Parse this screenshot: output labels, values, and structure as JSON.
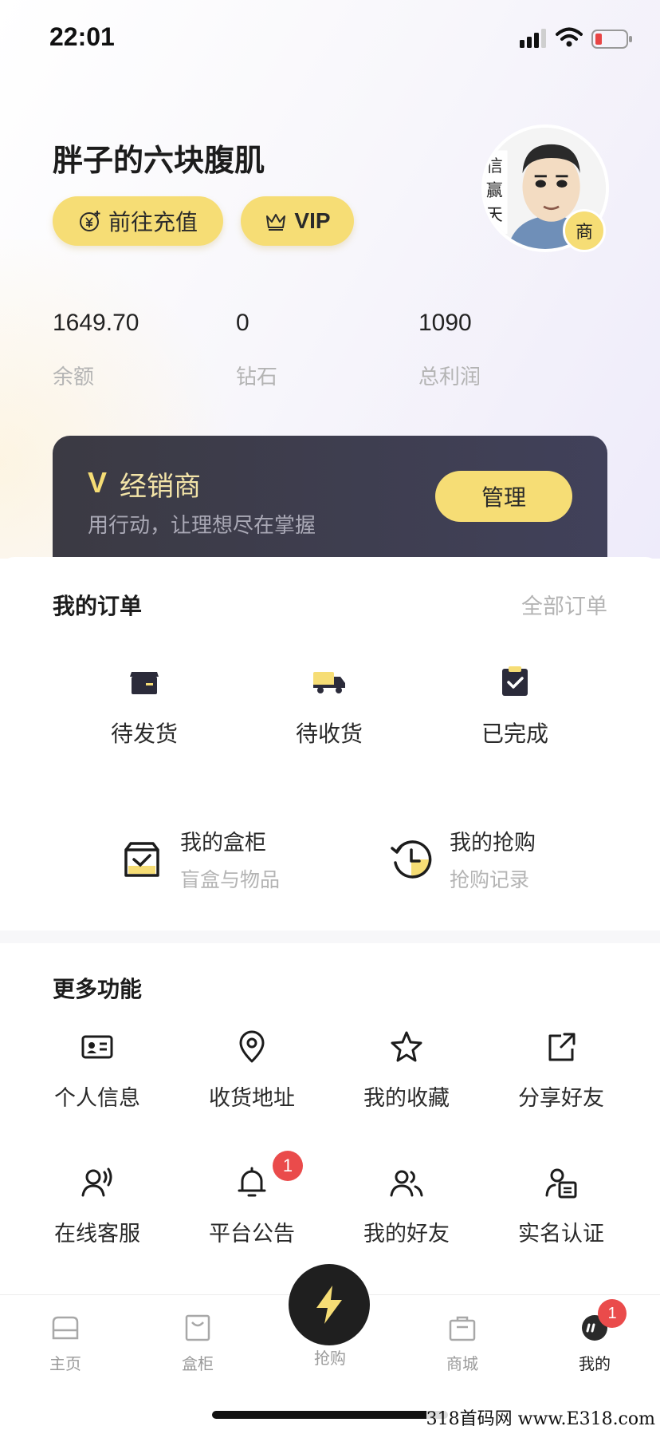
{
  "status_bar": {
    "time": "22:01"
  },
  "profile": {
    "username": "胖子的六块腹肌",
    "recharge_label": "前往充值",
    "vip_label": "VIP",
    "merchant_badge": "商",
    "avatar_text": [
      "信",
      "赢",
      "天"
    ]
  },
  "stats": [
    {
      "value": "1649.70",
      "label": "余额"
    },
    {
      "value": "0",
      "label": "钻石"
    },
    {
      "value": "1090",
      "label": "总利润"
    }
  ],
  "dealer": {
    "badge": "V",
    "title": "经销商",
    "subtitle": "用行动，让理想尽在掌握",
    "button": "管理"
  },
  "orders": {
    "title": "我的订单",
    "all_link": "全部订单",
    "items": [
      {
        "label": "待发货",
        "icon": "box-icon"
      },
      {
        "label": "待收货",
        "icon": "truck-icon"
      },
      {
        "label": "已完成",
        "icon": "clipboard-check-icon"
      }
    ]
  },
  "features": [
    {
      "title": "我的盒柜",
      "subtitle": "盲盒与物品",
      "icon": "cabinet-icon"
    },
    {
      "title": "我的抢购",
      "subtitle": "抢购记录",
      "icon": "history-clock-icon"
    }
  ],
  "more": {
    "title": "更多功能",
    "items": [
      {
        "label": "个人信息",
        "icon": "id-card-icon"
      },
      {
        "label": "收货地址",
        "icon": "location-pin-icon"
      },
      {
        "label": "我的收藏",
        "icon": "star-icon"
      },
      {
        "label": "分享好友",
        "icon": "share-icon"
      },
      {
        "label": "在线客服",
        "icon": "customer-service-icon"
      },
      {
        "label": "平台公告",
        "icon": "bell-icon",
        "badge": "1"
      },
      {
        "label": "我的好友",
        "icon": "friends-icon"
      },
      {
        "label": "实名认证",
        "icon": "verify-id-icon"
      }
    ]
  },
  "tabs": [
    {
      "label": "主页",
      "icon": "home-icon",
      "active": false
    },
    {
      "label": "盒柜",
      "icon": "bag-icon",
      "active": false
    },
    {
      "label": "抢购",
      "icon": "lightning-icon",
      "active": false
    },
    {
      "label": "商城",
      "icon": "shop-icon",
      "active": false
    },
    {
      "label": "我的",
      "icon": "chat-icon",
      "active": true,
      "badge": "1"
    }
  ],
  "watermark": "318首码网 www.E318.com",
  "colors": {
    "accent_yellow": "#f6dd75",
    "dark_card": "#3b3a43",
    "badge_red": "#ea4b4b",
    "muted_text": "#b4b4b4"
  }
}
